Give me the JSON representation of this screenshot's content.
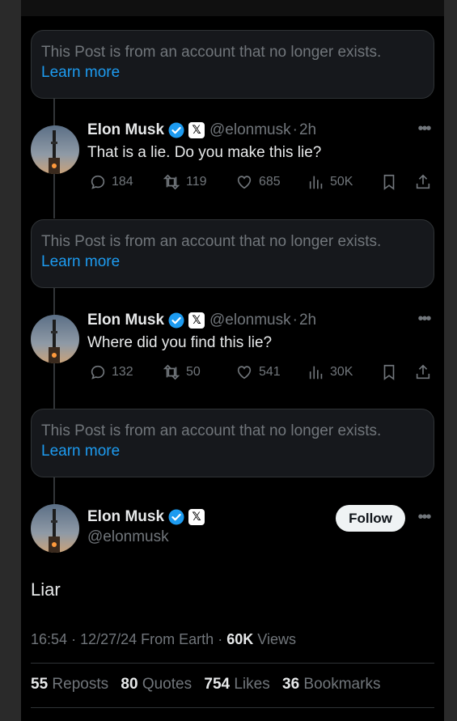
{
  "deleted_notice": {
    "message": "This Post is from an account that no longer exists.",
    "link": "Learn more"
  },
  "replies": [
    {
      "name": "Elon Musk",
      "handle": "@elonmusk",
      "dot": "·",
      "time": "2h",
      "text": "That is a lie. Do you make this lie?",
      "replies": "184",
      "reposts": "119",
      "likes": "685",
      "views": "50K"
    },
    {
      "name": "Elon Musk",
      "handle": "@elonmusk",
      "dot": "·",
      "time": "2h",
      "text": "Where did you find this lie?",
      "replies": "132",
      "reposts": "50",
      "likes": "541",
      "views": "30K"
    }
  ],
  "main_post": {
    "name": "Elon Musk",
    "handle": "@elonmusk",
    "follow_label": "Follow",
    "text": "Liar",
    "time": "16:54",
    "date": "12/27/24",
    "source": "From Earth",
    "views_count": "60K",
    "views_label": "Views",
    "sep": "·",
    "stats": {
      "reposts_count": "55",
      "reposts_label": "Reposts",
      "quotes_count": "80",
      "quotes_label": "Quotes",
      "likes_count": "754",
      "likes_label": "Likes",
      "bookmarks_count": "36",
      "bookmarks_label": "Bookmarks"
    }
  },
  "icons": {
    "verified": "verified-badge-icon",
    "x_logo": "x-logo-icon",
    "more": "more-icon",
    "reply": "reply-icon",
    "repost": "repost-icon",
    "like": "like-icon",
    "views": "views-icon",
    "bookmark": "bookmark-icon",
    "share": "share-icon"
  },
  "colors": {
    "background": "#000000",
    "accent": "#1d9bf0",
    "muted": "#71767b",
    "text": "#e7e9ea"
  }
}
